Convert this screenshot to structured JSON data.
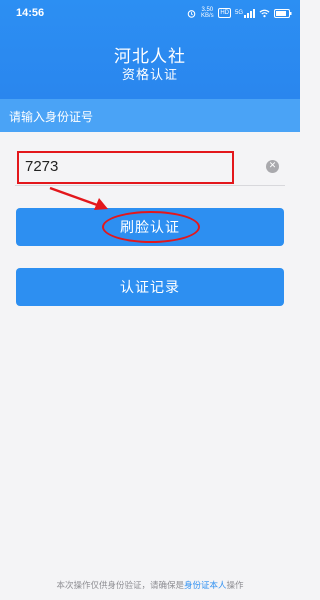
{
  "status_bar": {
    "time": "14:56",
    "net_speed_value": "3.50",
    "net_speed_unit": "KB/s",
    "hd_badge": "HD",
    "signal_label": "5G"
  },
  "header": {
    "title": "河北人社",
    "subtitle": "资格认证"
  },
  "form": {
    "section_label": "请输入身份证号",
    "id_number_value": "7273",
    "clear_icon": "clear-icon"
  },
  "buttons": {
    "face_auth_label": "刷脸认证",
    "records_label": "认证记录"
  },
  "footer": {
    "text_before": "本次操作仅供身份验证，请确保是",
    "link_text": "身份证本人",
    "text_after": "操作"
  },
  "colors": {
    "header_blue": "#2c8ff3",
    "section_blue": "#4aa3f6",
    "button_blue": "#2d8ff1",
    "annotation_red": "#e3171c"
  }
}
